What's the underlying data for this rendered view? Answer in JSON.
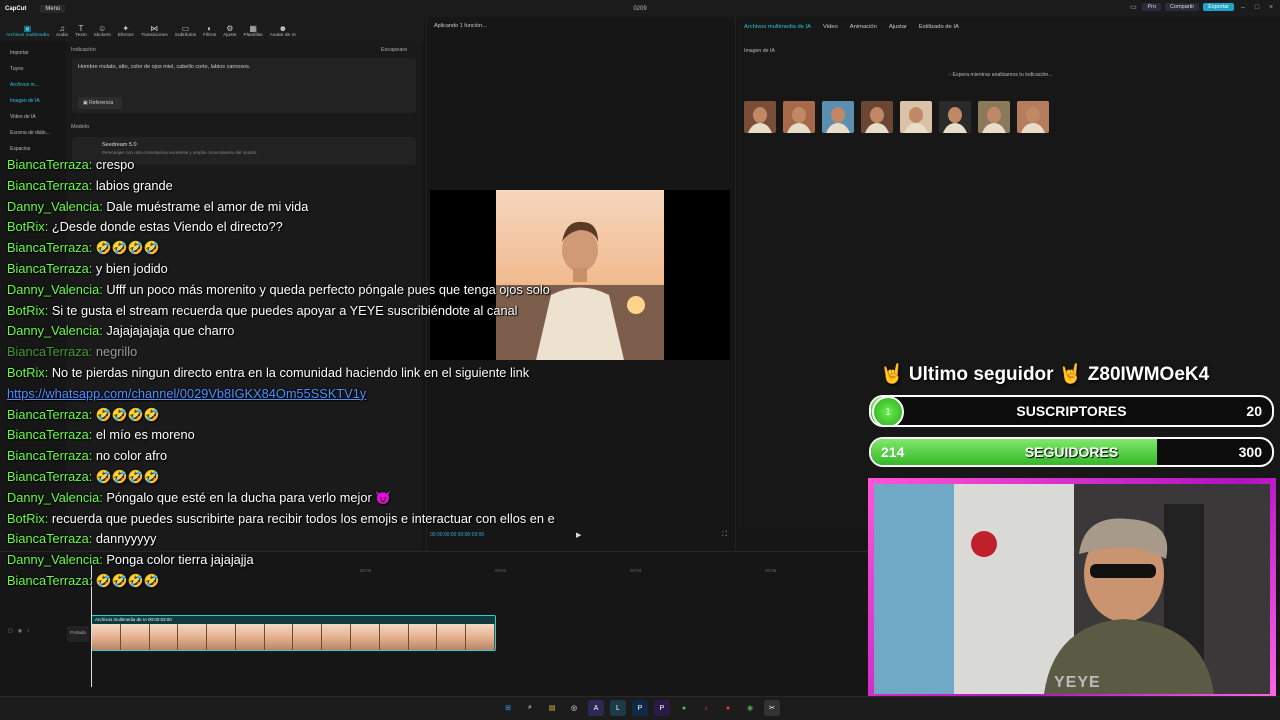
{
  "app": {
    "logo": "CapCut",
    "menu": "Menú",
    "title": "0209",
    "pro": "Pro",
    "share": "Compartir",
    "export": "Exportar"
  },
  "toolbar": [
    {
      "label": "Archivos multimedia",
      "icon": "media-icon",
      "active": true
    },
    {
      "label": "Audio",
      "icon": "audio-icon"
    },
    {
      "label": "Texto",
      "icon": "text-icon"
    },
    {
      "label": "Stickers",
      "icon": "sticker-icon"
    },
    {
      "label": "Efectos",
      "icon": "effects-icon"
    },
    {
      "label": "Transiciones",
      "icon": "transitions-icon"
    },
    {
      "label": "Subtítulos",
      "icon": "subtitles-icon"
    },
    {
      "label": "Filtros",
      "icon": "filters-icon"
    },
    {
      "label": "Ajuste",
      "icon": "adjust-icon"
    },
    {
      "label": "Plantillas",
      "icon": "templates-icon"
    },
    {
      "label": "Avatar de IA",
      "icon": "avatar-icon"
    }
  ],
  "leftnav": [
    "Importar",
    "Tuyos",
    "Archivos m...",
    "Imagen de IA",
    "Video de IA",
    "Escena de diálo...",
    "Espacios"
  ],
  "panel": {
    "indicacion": "Indicación",
    "escapear": "Escapeare",
    "prompt": "Hombre mulato, alto, color de ojos miel, cabello corto, labios carnosos.",
    "reference": "Referencia",
    "modelo": "Modelo",
    "model_name": "Seedream 5.0",
    "model_desc": "Personajes con una consistencia excelente y amplio conocimiento del mundo"
  },
  "preview": {
    "header": "Aplicando 1 función...",
    "time": "00:00:00:00  00:00:03:00"
  },
  "right": {
    "tabs": [
      "Archivos multimedia de IA",
      "Video",
      "Animación",
      "Ajustar",
      "Estilizado de IA"
    ],
    "sub": "Imagen de IA",
    "waiting": "Espera mientras analizamos tu indicación..."
  },
  "timeline": {
    "ticks": [
      "00:00",
      "00:02",
      "00:04",
      "00:06"
    ],
    "clip_label": "Archivos multimedia de IA  00:00:03:00",
    "cover": "Portada"
  },
  "chat": [
    {
      "user": "BiancaTerraza",
      "text": "crespo"
    },
    {
      "user": "BiancaTerraza",
      "text": "labios grande"
    },
    {
      "user": "Danny_Valencia",
      "text": "Dale muéstrame el amor de mi vida"
    },
    {
      "user": "BotRix",
      "text": "¿Desde donde estas Viendo el directo??"
    },
    {
      "user": "BiancaTerraza",
      "text": "🤣🤣🤣🤣"
    },
    {
      "user": "BiancaTerraza",
      "text": "y bien jodido"
    },
    {
      "user": "Danny_Valencia",
      "text": "Ufff un poco más morenito y queda perfecto póngale pues que tenga ojos solo"
    },
    {
      "user": "BotRix",
      "text": "Si te gusta el stream recuerda que puedes apoyar a YEYE suscribiéndote al canal"
    },
    {
      "user": "Danny_Valencia",
      "text": "Jajajajajaja que charro"
    },
    {
      "user": "BiancaTerraza",
      "text": "negrillo",
      "dim": true
    },
    {
      "user": "BotRix",
      "text": "No te pierdas ningun directo entra en la comunidad haciendo link en el siguiente link"
    },
    {
      "user": "",
      "text": "https://whatsapp.com/channel/0029Vb8IGKX84Om55SSKTV1y",
      "link": true
    },
    {
      "user": "BiancaTerraza",
      "text": "🤣🤣🤣🤣"
    },
    {
      "user": "BiancaTerraza",
      "text": "el mío es moreno"
    },
    {
      "user": "BiancaTerraza",
      "text": "no color afro"
    },
    {
      "user": "BiancaTerraza",
      "text": "🤣🤣🤣🤣"
    },
    {
      "user": "Danny_Valencia",
      "text": "Póngalo que esté en la ducha para verlo mejor 😈"
    },
    {
      "user": "BotRix",
      "text": "recuerda que puedes suscribirte para recibir todos los emojis e interactuar con ellos en e"
    },
    {
      "user": "BiancaTerraza",
      "text": "dannyyyyy"
    },
    {
      "user": "Danny_Valencia",
      "text": "Ponga color tierra jajajajja"
    },
    {
      "user": "BiancaTerraza",
      "text": "🤣🤣🤣🤣"
    }
  ],
  "overlay": {
    "last_follower": "🤘 Ultimo seguidor 🤘 Z80IWMOeK4",
    "subs": {
      "label": "SUSCRIPTORES",
      "current": "1",
      "goal": "20",
      "fraction": 0.05
    },
    "followers": {
      "label": "SEGUIDORES",
      "current": "214",
      "goal": "300",
      "fraction": 0.713
    },
    "cam_label": "YEYE"
  },
  "colors": {
    "accent": "#29c4d6",
    "chat_user": "#66ff44",
    "goal_green": "#4cd63a",
    "cam_border": "#e040e0"
  }
}
